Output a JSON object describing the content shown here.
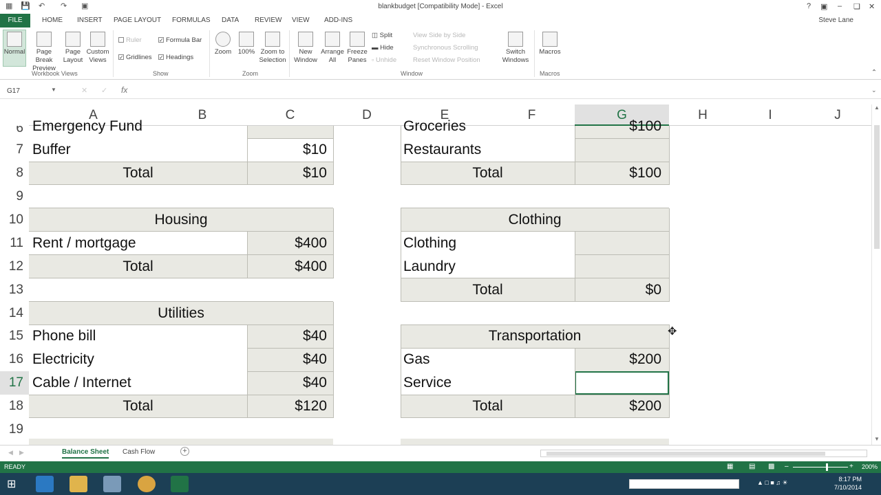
{
  "window": {
    "title": "blankbudget  [Compatibility Mode] - Excel",
    "user": "Steve Lane"
  },
  "tabs": [
    "FILE",
    "HOME",
    "INSERT",
    "PAGE LAYOUT",
    "FORMULAS",
    "DATA",
    "REVIEW",
    "VIEW",
    "ADD-INS"
  ],
  "ribbon": {
    "normal": "Normal",
    "page_break": "Page Break\nPreview",
    "page_layout": "Page\nLayout",
    "custom_views": "Custom\nViews",
    "ruler": "Ruler",
    "formula_bar": "Formula Bar",
    "gridlines": "Gridlines",
    "headings": "Headings",
    "zoom": "Zoom",
    "zoom100": "100%",
    "zoom_selection": "Zoom to\nSelection",
    "new_window": "New\nWindow",
    "arrange_all": "Arrange\nAll",
    "freeze_panes": "Freeze\nPanes",
    "split": "Split",
    "hide": "Hide",
    "unhide": "Unhide",
    "view_side": "View Side by Side",
    "sync_scroll": "Synchronous Scrolling",
    "reset_pos": "Reset Window Position",
    "switch_windows": "Switch\nWindows",
    "macros": "Macros",
    "groups": {
      "workbook_views": "Workbook Views",
      "show": "Show",
      "zoom": "Zoom",
      "window": "Window",
      "macros": "Macros"
    }
  },
  "formula_bar": {
    "name_box": "G17",
    "fx": "fx",
    "value": ""
  },
  "columns": [
    "A",
    "B",
    "C",
    "D",
    "E",
    "F",
    "G",
    "H",
    "I",
    "J"
  ],
  "rows": [
    "6",
    "7",
    "8",
    "9",
    "10",
    "11",
    "12",
    "13",
    "14",
    "15",
    "16",
    "17",
    "18",
    "19"
  ],
  "left_block": {
    "r6_label": "Emergency Fund",
    "r7_label": "Buffer",
    "r7_value": "$10",
    "r8_total": "Total",
    "r8_value": "$10",
    "housing": "Housing",
    "r11_label": "Rent / mortgage",
    "r11_value": "$400",
    "r12_total": "Total",
    "r12_value": "$400",
    "utilities": "Utilities",
    "r15_label": "Phone bill",
    "r15_value": "$40",
    "r16_label": "Electricity",
    "r16_value": "$40",
    "r17_label": "Cable / Internet",
    "r17_value": "$40",
    "r18_total": "Total",
    "r18_value": "$120"
  },
  "right_block": {
    "r6_label": "Groceries",
    "r6_value": "$100",
    "r7_label": "Restaurants",
    "r8_total": "Total",
    "r8_value": "$100",
    "clothing": "Clothing",
    "r11_label": "Clothing",
    "r12_label": "Laundry",
    "r13_total": "Total",
    "r13_value": "$0",
    "transportation": "Transportation",
    "r16_label": "Gas",
    "r16_value": "$200",
    "r17_label": "Service",
    "r18_total": "Total",
    "r18_value": "$200"
  },
  "sheets": [
    "Balance Sheet",
    "Cash Flow"
  ],
  "status": {
    "ready": "READY",
    "zoom": "200%"
  },
  "taskbar": {
    "time": "8:17 PM",
    "date": "7/10/2014"
  },
  "colors": {
    "accent": "#217346",
    "table_fill": "#e9e9e3",
    "taskbar": "#1c3f55"
  }
}
